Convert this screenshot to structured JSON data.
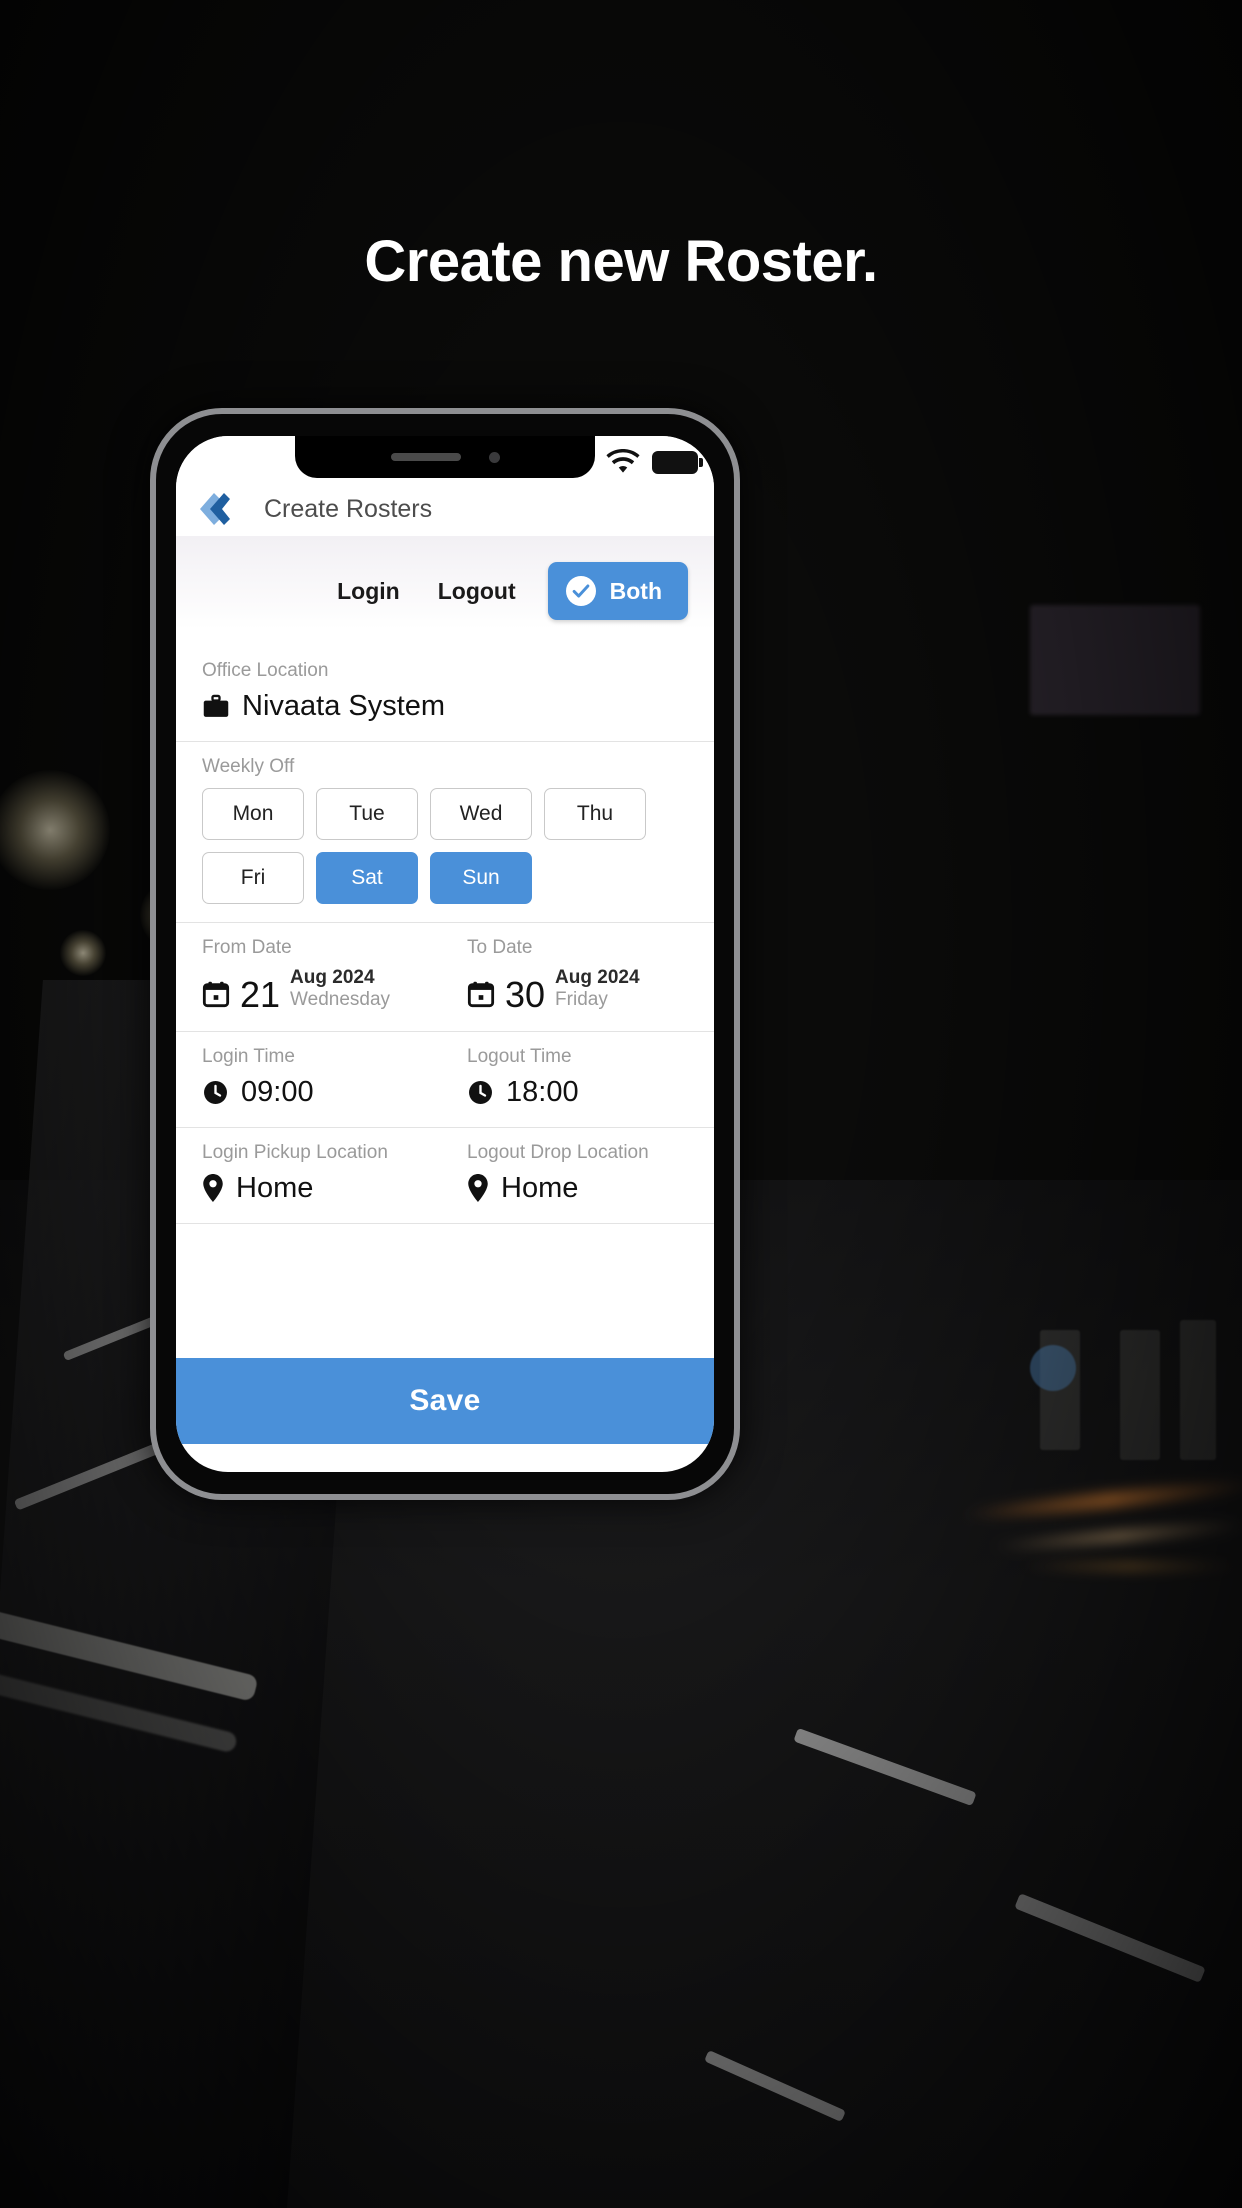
{
  "headline": "Create new Roster.",
  "status_bar": {
    "wifi_icon": "wifi-icon",
    "battery_icon": "battery-icon"
  },
  "app": {
    "back_icon": "double-chevron-left-icon",
    "header_title": "Create Rosters",
    "tabs": [
      {
        "label": "Login",
        "active": false
      },
      {
        "label": "Logout",
        "active": false
      },
      {
        "label": "Both",
        "active": true,
        "icon": "check-circle-icon"
      }
    ],
    "office_location": {
      "label": "Office Location",
      "value": "Nivaata System",
      "icon": "briefcase-icon"
    },
    "weekly_off": {
      "label": "Weekly Off",
      "days": [
        {
          "label": "Mon",
          "selected": false
        },
        {
          "label": "Tue",
          "selected": false
        },
        {
          "label": "Wed",
          "selected": false
        },
        {
          "label": "Thu",
          "selected": false
        },
        {
          "label": "Fri",
          "selected": false
        },
        {
          "label": "Sat",
          "selected": true
        },
        {
          "label": "Sun",
          "selected": true
        }
      ]
    },
    "from_date": {
      "label": "From Date",
      "icon": "calendar-icon",
      "day": "21",
      "month_year": "Aug 2024",
      "weekday": "Wednesday"
    },
    "to_date": {
      "label": "To Date",
      "icon": "calendar-icon",
      "day": "30",
      "month_year": "Aug 2024",
      "weekday": "Friday"
    },
    "login_time": {
      "label": "Login Time",
      "icon": "clock-icon",
      "value": "09:00"
    },
    "logout_time": {
      "label": "Logout Time",
      "icon": "clock-icon",
      "value": "18:00"
    },
    "login_pickup": {
      "label": "Login Pickup Location",
      "icon": "map-pin-icon",
      "value": "Home"
    },
    "logout_drop": {
      "label": "Logout Drop Location",
      "icon": "map-pin-icon",
      "value": "Home"
    },
    "save_label": "Save"
  },
  "colors": {
    "accent": "#4a90d9",
    "label_gray": "#9a9a9a",
    "text_dark": "#111111"
  }
}
